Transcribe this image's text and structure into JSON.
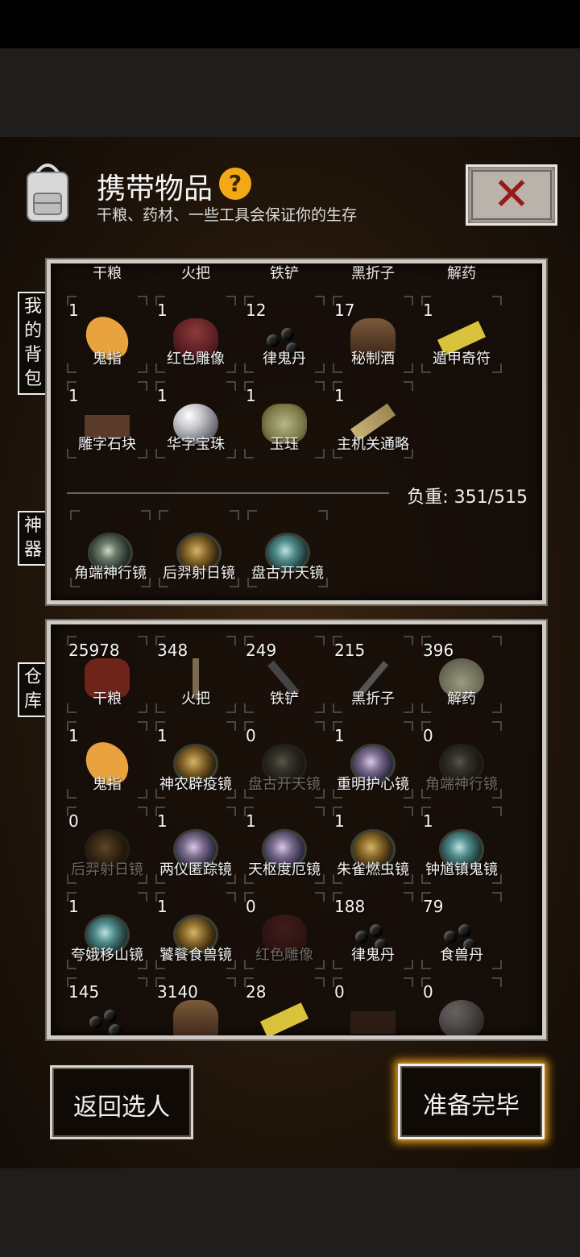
{
  "header": {
    "title": "携带物品",
    "help_icon": "help-question-icon",
    "subtitle": "干粮、药材、一些工具会保证你的生存",
    "close_icon": "close-x-icon"
  },
  "tabs": {
    "backpack": "我的背包",
    "artifacts": "神器",
    "warehouse": "仓库"
  },
  "backpack": {
    "headers": [
      "干粮",
      "火把",
      "铁铲",
      "黑折子",
      "解药"
    ],
    "items": [
      {
        "count": "1",
        "label": "鬼指",
        "icon": "finger"
      },
      {
        "count": "1",
        "label": "红色雕像",
        "icon": "statue"
      },
      {
        "count": "12",
        "label": "律鬼丹",
        "icon": "pills"
      },
      {
        "count": "17",
        "label": "秘制酒",
        "icon": "bottle"
      },
      {
        "count": "1",
        "label": "遁甲奇符",
        "icon": "talisman"
      },
      {
        "count": "1",
        "label": "雕字石块",
        "icon": "block"
      },
      {
        "count": "1",
        "label": "华字宝珠",
        "icon": "pearl"
      },
      {
        "count": "1",
        "label": "玉珏",
        "icon": "jade"
      },
      {
        "count": "1",
        "label": "主机关通略",
        "icon": "scroll"
      }
    ],
    "weight_text": "负重: 351/515"
  },
  "artifacts": [
    {
      "label": "角端神行镜",
      "icon": "mirror"
    },
    {
      "label": "后羿射日镜",
      "icon": "mirror-gold"
    },
    {
      "label": "盘古开天镜",
      "icon": "mirror-teal"
    }
  ],
  "warehouse": {
    "items": [
      {
        "count": "25978",
        "label": "干粮",
        "icon": "meat",
        "dim": false
      },
      {
        "count": "348",
        "label": "火把",
        "icon": "torch",
        "dim": false
      },
      {
        "count": "249",
        "label": "铁铲",
        "icon": "shovel",
        "dim": false
      },
      {
        "count": "215",
        "label": "黑折子",
        "icon": "pick",
        "dim": false
      },
      {
        "count": "396",
        "label": "解药",
        "icon": "gourd",
        "dim": false
      },
      {
        "count": "1",
        "label": "鬼指",
        "icon": "finger",
        "dim": false
      },
      {
        "count": "1",
        "label": "神农辟疫镜",
        "icon": "mirror-gold",
        "dim": false
      },
      {
        "count": "0",
        "label": "盘古开天镜",
        "icon": "mirror",
        "dim": true
      },
      {
        "count": "1",
        "label": "重明护心镜",
        "icon": "mirror-purple",
        "dim": false
      },
      {
        "count": "0",
        "label": "角端神行镜",
        "icon": "mirror",
        "dim": true
      },
      {
        "count": "0",
        "label": "后羿射日镜",
        "icon": "mirror-gold",
        "dim": true
      },
      {
        "count": "1",
        "label": "两仪匿踪镜",
        "icon": "mirror-purple",
        "dim": false
      },
      {
        "count": "1",
        "label": "天枢度厄镜",
        "icon": "mirror-purple",
        "dim": false
      },
      {
        "count": "1",
        "label": "朱雀燃虫镜",
        "icon": "mirror-gold",
        "dim": false
      },
      {
        "count": "1",
        "label": "钟馗镇鬼镜",
        "icon": "mirror-teal",
        "dim": false
      },
      {
        "count": "1",
        "label": "夸娥移山镜",
        "icon": "mirror-teal",
        "dim": false
      },
      {
        "count": "1",
        "label": "饕餮食兽镜",
        "icon": "mirror-gold",
        "dim": false
      },
      {
        "count": "0",
        "label": "红色雕像",
        "icon": "statue",
        "dim": true
      },
      {
        "count": "188",
        "label": "律鬼丹",
        "icon": "pills",
        "dim": false
      },
      {
        "count": "79",
        "label": "食兽丹",
        "icon": "pills",
        "dim": false
      },
      {
        "count": "145",
        "label": "",
        "icon": "pills",
        "dim": false
      },
      {
        "count": "3140",
        "label": "",
        "icon": "bottle",
        "dim": false
      },
      {
        "count": "28",
        "label": "",
        "icon": "talisman",
        "dim": false
      },
      {
        "count": "0",
        "label": "",
        "icon": "block",
        "dim": true
      },
      {
        "count": "0",
        "label": "",
        "icon": "pearl",
        "dim": true
      }
    ]
  },
  "buttons": {
    "back": "返回选人",
    "ready": "准备完毕"
  },
  "colors": {
    "accent_glow": "#e9a21a",
    "close_x": "#9c1818",
    "help_badge": "#f3a915"
  }
}
